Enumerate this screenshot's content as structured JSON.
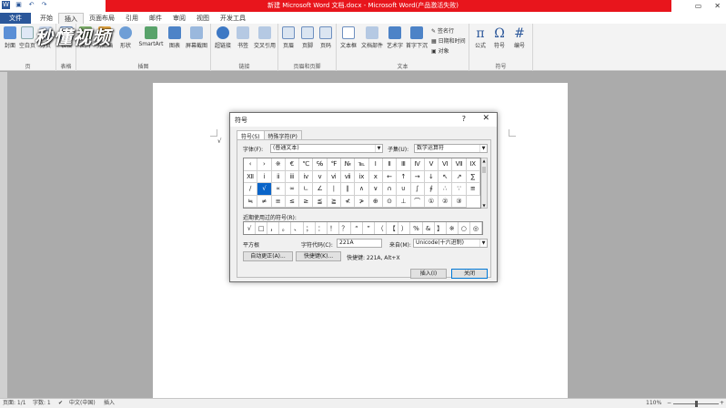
{
  "window": {
    "title": "新建 Microsoft Word 文档.docx - Microsoft Word(产品激活失败)",
    "controls": [
      "▭",
      "▭",
      "✕"
    ]
  },
  "quick_access": [
    "save-icon",
    "undo-icon",
    "redo-icon"
  ],
  "tabs": [
    "文件",
    "开始",
    "插入",
    "页面布局",
    "引用",
    "邮件",
    "审阅",
    "视图",
    "开发工具"
  ],
  "watermark": "秒懂视频",
  "ribbon": {
    "groups": [
      "页",
      "表格",
      "插图",
      "链接",
      "页眉和页脚",
      "文本",
      "符号"
    ],
    "buttons": {
      "cover": "封面",
      "blank": "空白页",
      "pagebreak": "分页",
      "table": "表格",
      "picture": "图片",
      "clipart": "剪贴画",
      "shapes": "形状",
      "smartart": "SmartArt",
      "chart": "图表",
      "screenshot": "屏幕截图",
      "hyperlink": "超链接",
      "bookmark": "书签",
      "crossref": "交叉引用",
      "header": "页眉",
      "footer": "页脚",
      "pagenum": "页码",
      "textbox": "文本框",
      "quickparts": "文档部件",
      "wordart": "艺术字",
      "dropcap": "首字下沉",
      "signature": "签名行",
      "datetime": "日期和时间",
      "object": "对象",
      "equation": "公式",
      "symbol": "符号",
      "number": "编号"
    },
    "glyphs": {
      "equation": "π",
      "symbol": "Ω",
      "number": "#"
    }
  },
  "document": {
    "visible_text": "√"
  },
  "dialog": {
    "title": "符号",
    "help": "?",
    "close": "✕",
    "tabs": [
      "符号(S)",
      "特殊字符(P)"
    ],
    "font_label": "字体(F):",
    "font_value": "(普通文本)",
    "subset_label": "子集(U):",
    "subset_value": "数学运算符",
    "symbols": [
      "‹",
      "›",
      "※",
      "€",
      "℃",
      "℅",
      "℉",
      "№",
      "℡",
      "Ⅰ",
      "Ⅱ",
      "Ⅲ",
      "Ⅳ",
      "Ⅴ",
      "Ⅵ",
      "Ⅶ",
      "Ⅸ",
      "Ⅻ",
      "ⅰ",
      "ⅱ",
      "ⅲ",
      "ⅳ",
      "ⅴ",
      "ⅵ",
      "ⅶ",
      "ⅸ",
      "x",
      "←",
      "↑",
      "→",
      "↓",
      "↖",
      "↗",
      "∑",
      "∕",
      "√",
      "∝",
      "∞",
      "∟",
      "∠",
      "∣",
      "∥",
      "∧",
      "∨",
      "∩",
      "∪",
      "∫",
      "∮",
      "∴",
      "∵",
      "≌",
      "≒",
      "≠",
      "≡",
      "≤",
      "≥",
      "≦",
      "≧",
      "≮",
      "≯",
      "⊕",
      "⊙",
      "⊥",
      "⌒",
      "①",
      "②",
      "③"
    ],
    "selected_symbol": "√",
    "recent_label": "近期使用过的符号(R):",
    "recent": [
      "√",
      "□",
      "，",
      "。",
      "、",
      "；",
      "：",
      "！",
      "？",
      "“",
      "”",
      "（",
      "【",
      "）",
      "%",
      "&",
      "】",
      "※",
      "○",
      "◎"
    ],
    "char_name": "平方根",
    "charcode_label": "字符代码(C):",
    "charcode_value": "221A",
    "from_label": "来自(M):",
    "from_value": "Unicode(十六进制)",
    "autocorrect_button": "自动更正(A)...",
    "shortcut_button": "快捷键(K)...",
    "shortcut_text": "快捷键: 221A, Alt+X",
    "insert_button": "插入(I)",
    "close_button": "关闭"
  },
  "status": {
    "page": "页面: 1/1",
    "words": "字数: 1",
    "lang": "中文(中国)",
    "mode": "插入",
    "zoom": "110%",
    "zoom_fraction": 0.5
  }
}
